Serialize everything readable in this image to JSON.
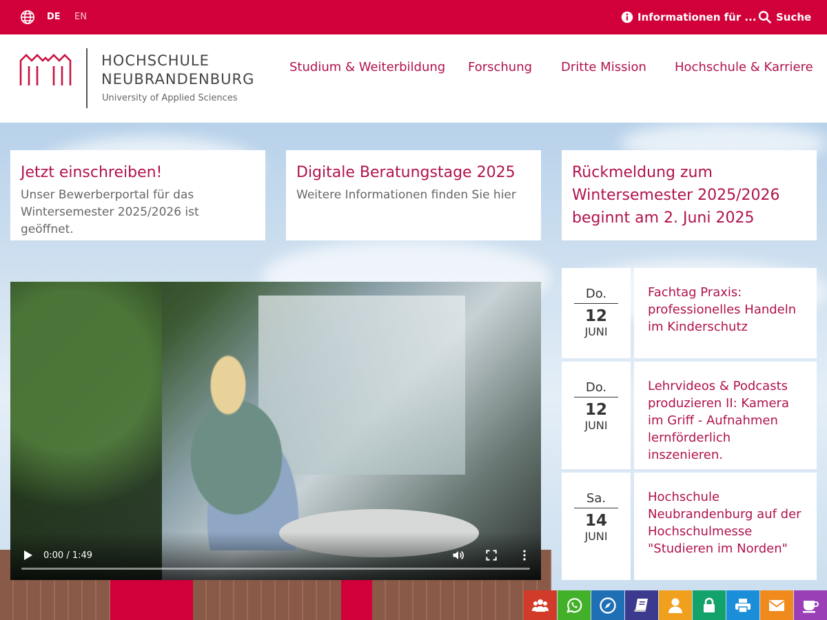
{
  "topbar": {
    "lang_de": "DE",
    "lang_en": "EN",
    "info_label": "Informationen für ...",
    "search_label": "Suche",
    "bg_color": "#d2003a"
  },
  "logo": {
    "line1": "HOCHSCHULE",
    "line2": "NEUBRANDENBURG",
    "line3": "University of Applied Sciences"
  },
  "nav": [
    {
      "label": "Studium & Weiterbildung"
    },
    {
      "label": "Forschung"
    },
    {
      "label": "Dritte Mission"
    },
    {
      "label": "Hochschule & Karriere"
    }
  ],
  "cards": [
    {
      "title": "Jetzt einschreiben!",
      "text": "Unser Bewerberportal für das Wintersemester 2025/2026 ist geöffnet."
    },
    {
      "title": "Digitale Beratungstage 2025",
      "text": "Weitere Informationen finden Sie hier"
    },
    {
      "title": "Rückmeldung zum Wintersemester 2025/2026 beginnt am 2. Juni 2025",
      "text": ""
    }
  ],
  "video": {
    "time": "0:00 / 1:49"
  },
  "events": [
    {
      "weekday": "Do.",
      "day": "12",
      "month": "JUNI",
      "title": "Fachtag Praxis: professionelles Handeln im Kinderschutz"
    },
    {
      "weekday": "Do.",
      "day": "12",
      "month": "JUNI",
      "title": "Lehrvideos & Podcasts produzieren II: Kamera im Griff - Aufnahmen lernförderlich inszenieren."
    },
    {
      "weekday": "Sa.",
      "day": "14",
      "month": "JUNI",
      "title": "Hochschule Neubrandenburg auf der Hochschulmesse \"Studieren im Norden\""
    }
  ],
  "quick_links": [
    {
      "icon": "users-icon",
      "color": "#d23b2a"
    },
    {
      "icon": "whatsapp-icon",
      "color": "#43b02a"
    },
    {
      "icon": "compass-icon",
      "color": "#1f6fb5"
    },
    {
      "icon": "book-icon",
      "color": "#3c3a8f"
    },
    {
      "icon": "user-icon",
      "color": "#f0a01c"
    },
    {
      "icon": "lock-icon",
      "color": "#13a36a"
    },
    {
      "icon": "print-icon",
      "color": "#1a8ed8"
    },
    {
      "icon": "mail-icon",
      "color": "#f08a1c"
    },
    {
      "icon": "coffee-icon",
      "color": "#9a3fb5"
    }
  ]
}
